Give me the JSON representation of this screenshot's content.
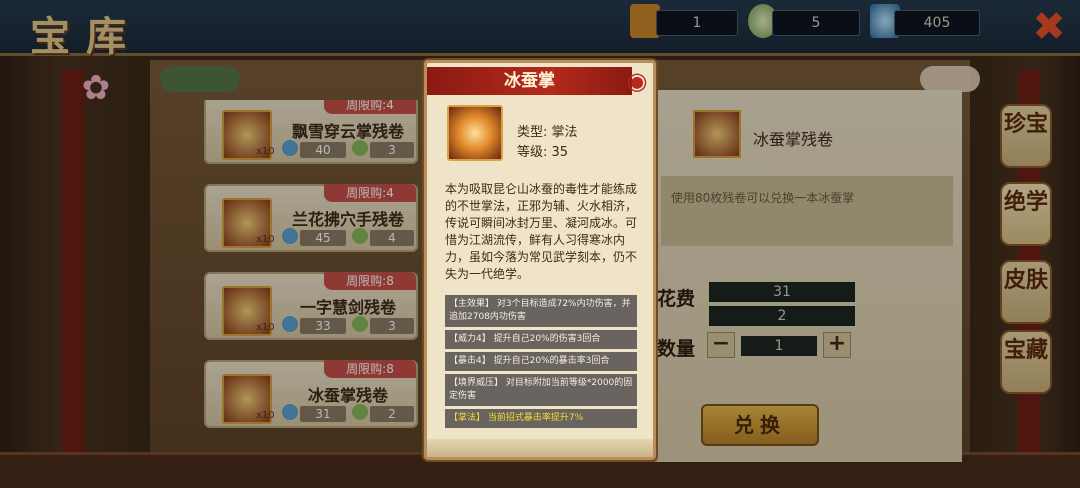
{
  "header": {
    "title": "宝库"
  },
  "resources": [
    {
      "icon": "scroll-ticket-icon",
      "value": "1"
    },
    {
      "icon": "jade-orb-icon",
      "value": "5"
    },
    {
      "icon": "crystal-ore-icon",
      "value": "405"
    }
  ],
  "close_icon": "✖",
  "list": [
    {
      "limit": "周限购:4",
      "name": "飘雪穿云掌残卷",
      "x10": "x10",
      "cost_a": "40",
      "cost_b": "3"
    },
    {
      "limit": "周限购:4",
      "name": "兰花拂穴手残卷",
      "x10": "x10",
      "cost_a": "45",
      "cost_b": "4"
    },
    {
      "limit": "周限购:8",
      "name": "一字慧剑残卷",
      "x10": "x10",
      "cost_a": "33",
      "cost_b": "3"
    },
    {
      "limit": "周限购:8",
      "name": "冰蚕掌残卷",
      "x10": "x10",
      "cost_a": "31",
      "cost_b": "2"
    }
  ],
  "panel": {
    "item_name": "冰蚕掌残卷",
    "description": "使用80枚残卷可以兑换一本冰蚕掌",
    "cost_label": "花费",
    "cost_a": "31",
    "cost_b": "2",
    "qty_label": "数量",
    "qty_minus": "−",
    "qty_value": "1",
    "qty_plus": "+",
    "exchange": "兑换"
  },
  "tabs": [
    {
      "label": "珍宝"
    },
    {
      "label": "绝学"
    },
    {
      "label": "皮肤"
    },
    {
      "label": "宝藏"
    }
  ],
  "modal": {
    "title": "冰蚕掌",
    "type": "类型: 掌法",
    "level": "等级: 35",
    "description": "本为吸取昆仑山冰蚕的毒性才能练成的不世掌法，正邪为辅、火水相济，传说可瞬间冰封万里、凝河成冰。可惜为江湖流传，鲜有人习得寒冰内力，虽如今落为常见武学刻本，仍不失为一代绝学。",
    "effects": [
      {
        "text": "【主效果】 对3个目标造成72%内功伤害，并追加2708内功伤害",
        "highlight": false
      },
      {
        "text": "【威力4】 提升自己20%的伤害3回合",
        "highlight": false
      },
      {
        "text": "【暴击4】 提升自己20%的暴击率3回合",
        "highlight": false
      },
      {
        "text": "【境界威压】 对目标附加当前等级*2000的固定伤害",
        "highlight": false
      },
      {
        "text": "【掌法】 当前招式暴击率提升7%",
        "highlight": true
      }
    ]
  },
  "colors": {
    "accent_red": "#b52a1c",
    "gold": "#d9a23c",
    "highlight_yellow": "#f2dc30"
  }
}
